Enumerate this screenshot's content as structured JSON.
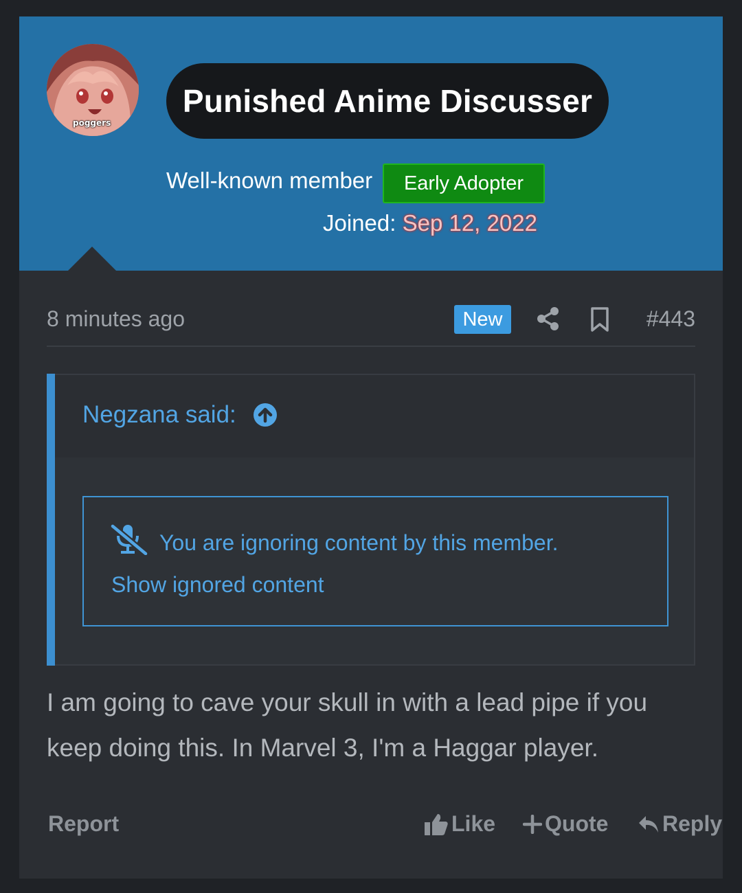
{
  "user": {
    "avatar_caption": "poggers",
    "name": "Punished Anime Discusser",
    "title": "Well-known member",
    "badge": "Early Adopter",
    "joined_label": "Joined:",
    "joined_date": "Sep 12, 2022"
  },
  "post": {
    "time": "8 minutes ago",
    "new_label": "New",
    "number": "#443",
    "body": "I am going to cave your skull in with a lead pipe if you keep doing this. In Marvel 3, I'm a Haggar player."
  },
  "quote": {
    "author_label": "Negzana said:",
    "ignore_message": "You are ignoring content by this member.",
    "show_label": "Show ignored content"
  },
  "actions": {
    "report": "Report",
    "like": "Like",
    "quote": "Quote",
    "reply": "Reply"
  },
  "colors": {
    "header": "#2471a6",
    "card": "#2b2e33",
    "link": "#52a5e4",
    "badge_green": "#0f8a12",
    "new_badge": "#3c9be0"
  },
  "icons": [
    "share-icon",
    "bookmark-icon",
    "arrow-up-circle-icon",
    "muted-microphone-icon",
    "thumbs-up-icon",
    "plus-icon",
    "reply-arrow-icon"
  ]
}
